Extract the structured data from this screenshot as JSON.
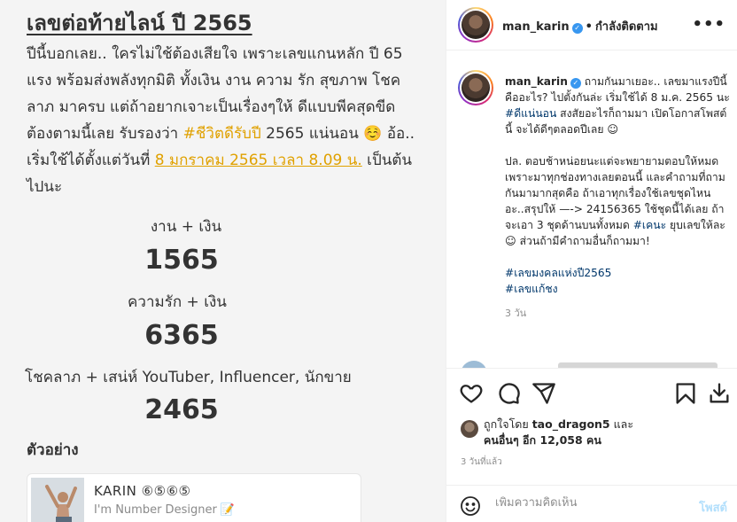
{
  "post_image": {
    "title": "เลขต่อท้ายไลน์ ปี 2565",
    "para_before": "ปีนี้บอกเลย.. ใครไม่ใช้ต้องเสียใจ เพราะเลขแกนหลัก ปี 65 แรง พร้อมส่งพลังทุกมิติ ทั้งเงิน งาน ความ รัก สุขภาพ โชคลาภ มาครบ แต่ถ้าอยากเจาะเป็นเรื่องๆให้ ดีแบบพีคสุดขีด ต้องตามนี้เลย รับรองว่า ",
    "para_hashtag": "#ชีวิตดีรับปี",
    "para_mid": " 2565 แน่นอน ☺️ อ้อ.. เริ่มใช้ได้ตั้งแต่วันที่ ",
    "para_date": "8 มกราคม 2565 เวลา 8.09 น.",
    "para_after": " เป็นต้นไปนะ",
    "label1": "งาน + เงิน",
    "num1": "1565",
    "label2": "ความรัก + เงิน",
    "num2": "6365",
    "label3": "โชคลาภ + เสน่ห์ YouTuber, Influencer, นักขาย",
    "num3": "2465",
    "example_label": "ตัวอย่าง",
    "card_name": "KARIN ⑥⑤⑥⑤",
    "card_sub": "I'm Number Designer 📝"
  },
  "header": {
    "username": "man_karin",
    "verified_mark": "✓",
    "dot": "•",
    "follow_status": "กำลังติดตาม",
    "more": "•••"
  },
  "caption": {
    "username": "man_karin",
    "p1_a": " ถามกันมาเยอะ.. เลขมาแรงปีนี้คืออะไร? ไปตั้งกันล่ะ เริ่มใช้ได้ 8 ม.ค. 2565 นะ ",
    "p1_tag": "#ดีแน่นอน",
    "p1_b": " สงสัยอะไรก็ถามมา เปิดโอกาสโพสต์นี้ จะได้ดีๆตลอดปีเลย ☺",
    "p2_a": "ปล. ตอบช้าหน่อยนะแต่จะพยายามตอบให้หมด เพราะมาทุกช่องทางเลยตอนนี้ และคำถามที่ถามกันมามากสุดคือ ถ้าเอาทุกเรื่องใช้เลขชุดไหน อะ..สรุปให้ —-> 24156365 ใช้ชุดนี้ได้เลย ถ้าจะเอา 3 ชุดด้านบนทั้งหมด ",
    "p2_tag": "#เคนะ",
    "p2_b": " ยุบเลขให้ละ ☺ ส่วนถ้ามีคำถามอื่นก็ถามมา!",
    "tag_a": "#เลขมงคลแห่งปี2565",
    "tag_b": "#เลขแก้ชง",
    "time": "3 วัน"
  },
  "actions": {
    "like_icon": "heart-icon",
    "comment_icon": "comment-icon",
    "share_icon": "share-icon",
    "save_icon": "bookmark-icon",
    "download_icon": "download-icon"
  },
  "likes": {
    "prefix": "ถูกใจโดย ",
    "liker": "tao_dragon5",
    "mid": " และ",
    "others": "คนอื่นๆ อีก 12,058 คน"
  },
  "posted": "3 วันที่แล้ว",
  "comment": {
    "placeholder": "เพิ่มความคิดเห็น",
    "post_label": "โพสต์"
  }
}
